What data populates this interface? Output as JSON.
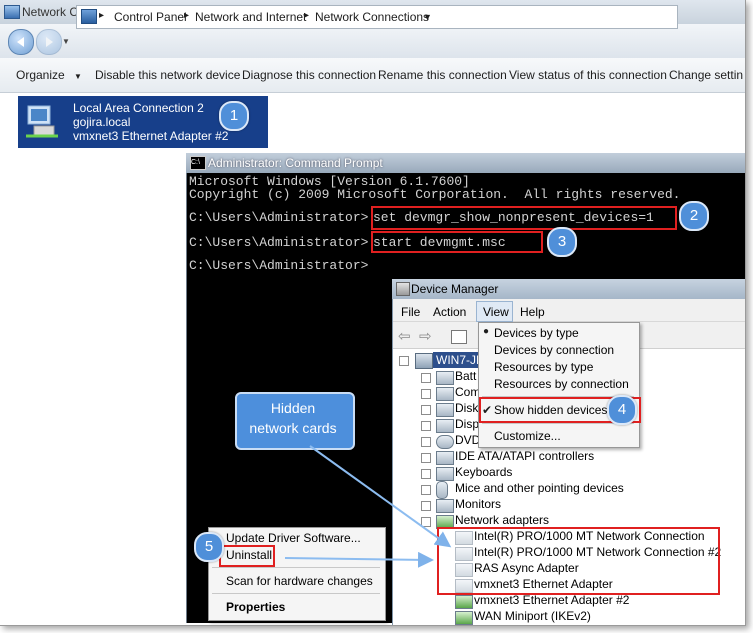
{
  "window": {
    "title": "Network Connections"
  },
  "address": {
    "crumbs": [
      "Control Panel",
      "Network and Internet",
      "Network Connections"
    ]
  },
  "toolbar": {
    "organize": "Organize",
    "disable": "Disable this network device",
    "diagnose": "Diagnose this connection",
    "rename": "Rename this connection",
    "view_status": "View status of this connection",
    "change_settings": "Change settin"
  },
  "connection": {
    "name": "Local Area Connection 2",
    "domain": "gojira.local",
    "adapter": "vmxnet3 Ethernet Adapter #2"
  },
  "cmd": {
    "title": "Administrator: Command Prompt",
    "line1": "Microsoft Windows [Version 6.1.7600]",
    "line2": "Copyright (c) 2009 Microsoft Corporation.  All rights reserved.",
    "prompt": "C:\\Users\\Administrator>",
    "cmd1": "set devmgr_show_nonpresent_devices=1",
    "cmd2": "start devmgmt.msc"
  },
  "device_manager": {
    "title": "Device Manager",
    "menu": [
      "File",
      "Action",
      "View",
      "Help"
    ],
    "root": "WIN7-JF",
    "tree": {
      "batt": "Batt",
      "com": "Com",
      "disk": "Disk",
      "disp": "Disp",
      "dvd": "DVD",
      "ide": "IDE ATA/ATAPI controllers",
      "keyboards": "Keyboards",
      "mice": "Mice and other pointing devices",
      "monitors": "Monitors",
      "network": "Network adapters",
      "nic1": "Intel(R) PRO/1000 MT Network Connection",
      "nic2": "Intel(R) PRO/1000 MT Network Connection #2",
      "ras": "RAS Async Adapter",
      "vmx1": "vmxnet3 Ethernet Adapter",
      "vmx2": "vmxnet3 Ethernet Adapter #2",
      "wan": "WAN Miniport (IKEv2)"
    },
    "view_menu": {
      "by_type": "Devices by type",
      "by_connection": "Devices by connection",
      "res_by_type": "Resources by type",
      "res_by_connection": "Resources by connection",
      "show_hidden": "Show hidden devices",
      "customize": "Customize..."
    }
  },
  "context_menu": {
    "update": "Update Driver Software...",
    "uninstall": "Uninstall",
    "scan": "Scan for hardware changes",
    "properties": "Properties"
  },
  "callout": {
    "line1": "Hidden",
    "line2": "network cards"
  },
  "badges": [
    "1",
    "2",
    "3",
    "4",
    "5"
  ]
}
